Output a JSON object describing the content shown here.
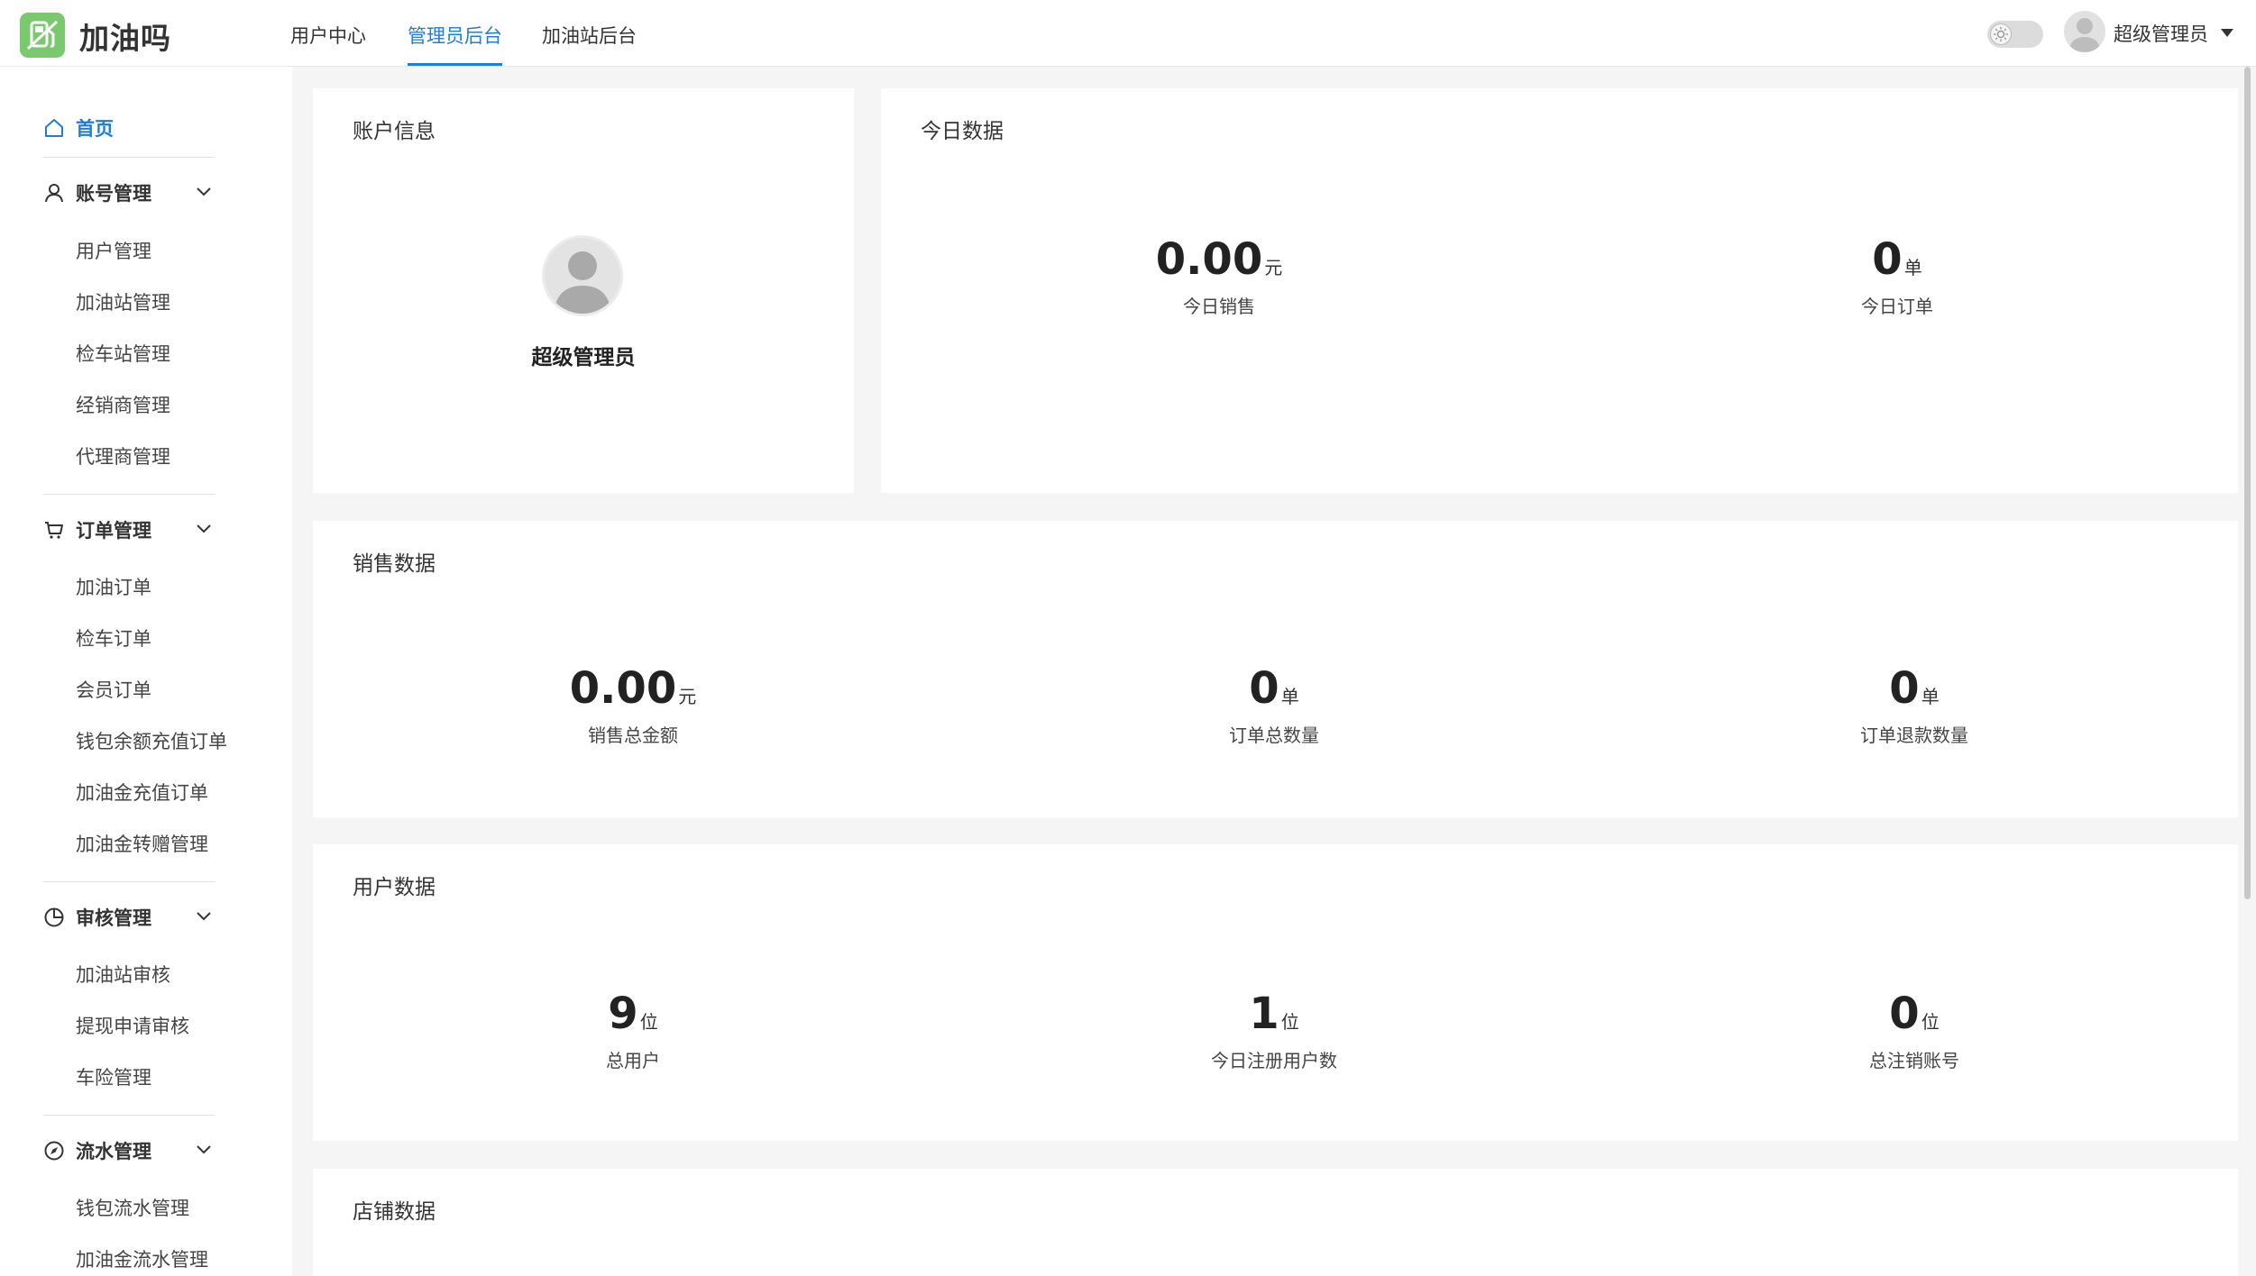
{
  "header": {
    "app_name": "加油吗",
    "tabs": [
      {
        "label": "用户中心"
      },
      {
        "label": "管理员后台"
      },
      {
        "label": "加油站后台"
      }
    ],
    "active_tab": "管理员后台",
    "user_name": "超级管理员"
  },
  "sidebar": {
    "home_label": "首页",
    "groups": [
      {
        "label": "账号管理",
        "icon": "user-icon",
        "items": [
          "用户管理",
          "加油站管理",
          "检车站管理",
          "经销商管理",
          "代理商管理"
        ]
      },
      {
        "label": "订单管理",
        "icon": "cart-icon",
        "items": [
          "加油订单",
          "检车订单",
          "会员订单",
          "钱包余额充值订单",
          "加油金充值订单",
          "加油金转赠管理"
        ]
      },
      {
        "label": "审核管理",
        "icon": "pie-chart-icon",
        "items": [
          "加油站审核",
          "提现申请审核",
          "车险管理"
        ]
      },
      {
        "label": "流水管理",
        "icon": "compass-icon",
        "items": [
          "钱包流水管理",
          "加油金流水管理"
        ]
      }
    ]
  },
  "account_card": {
    "title": "账户信息",
    "name": "超级管理员"
  },
  "today_card": {
    "title": "今日数据",
    "stats": [
      {
        "value": "0.00",
        "unit": "元",
        "label": "今日销售"
      },
      {
        "value": "0",
        "unit": "单",
        "label": "今日订单"
      }
    ]
  },
  "sales_card": {
    "title": "销售数据",
    "stats": [
      {
        "value": "0.00",
        "unit": "元",
        "label": "销售总金额"
      },
      {
        "value": "0",
        "unit": "单",
        "label": "订单总数量"
      },
      {
        "value": "0",
        "unit": "单",
        "label": "订单退款数量"
      }
    ]
  },
  "users_card": {
    "title": "用户数据",
    "stats": [
      {
        "value": "9",
        "unit": "位",
        "label": "总用户"
      },
      {
        "value": "1",
        "unit": "位",
        "label": "今日注册用户数"
      },
      {
        "value": "0",
        "unit": "位",
        "label": "总注销账号"
      }
    ]
  },
  "shop_card": {
    "title": "店铺数据"
  },
  "colors": {
    "accent": "#1e7dd6",
    "logo": "#7bc96f",
    "background": "#f5f5f5"
  }
}
